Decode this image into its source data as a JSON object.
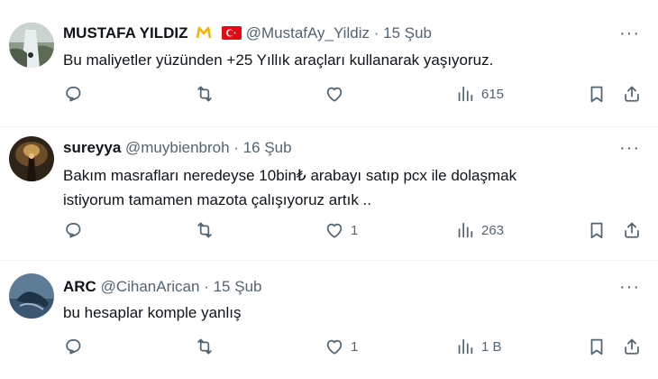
{
  "tweets": [
    {
      "name": "MUSTAFA YILDIZ",
      "handle": "@MustafAy_Yildiz",
      "dot": "·",
      "date": "15 Şub",
      "lines": [
        "Bu maliyetler yüzünden +25 Yıllık araçları kullanarak yaşıyoruz."
      ],
      "likes": "",
      "views": "615",
      "badges": [
        "gold-m-icon",
        "turkey-flag-icon"
      ]
    },
    {
      "name": "sureyya",
      "handle": "@muybienbroh",
      "dot": "·",
      "date": "16 Şub",
      "lines": [
        "Bakım masrafları neredeyse 10bin₺ arabayı satıp pcx ile dolaşmak",
        "istiyorum tamamen mazota çalışıyoruz artık .."
      ],
      "likes": "1",
      "views": "263"
    },
    {
      "name": "ARC",
      "handle": "@CihanArican",
      "dot": "·",
      "date": "15 Şub",
      "lines": [
        "bu hesaplar komple yanlış"
      ],
      "likes": "1",
      "views": "1 B"
    }
  ],
  "more_label": "···",
  "icons": [
    "reply-icon",
    "retweet-icon",
    "like-icon",
    "views-icon",
    "bookmark-icon",
    "share-icon"
  ],
  "colors": {
    "text": "#0f1419",
    "secondary": "#536471",
    "divider": "#eff3f4",
    "flag": "#e30a17",
    "badge": "#f4b400"
  }
}
